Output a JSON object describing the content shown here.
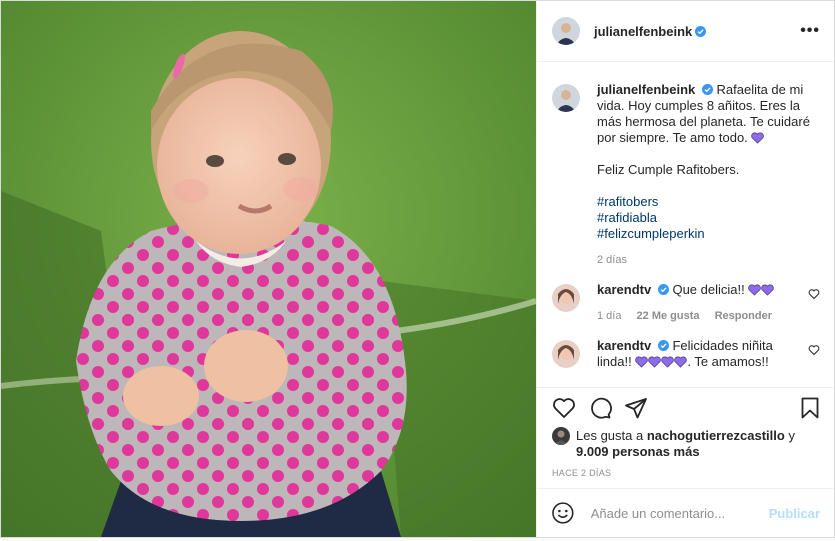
{
  "post": {
    "author": "julianelfenbeink",
    "more_label": "•••",
    "caption_lines": [
      "Rafaelita de mi vida. Hoy cumples 8 añitos. Eres la más hermosa del planeta. Te cuidaré por siempre. Te amo todo."
    ],
    "caption_second": "Feliz Cumple Rafitobers.",
    "hashtags": [
      "#rafitobers",
      "#rafidiabla",
      "#felizcumpleperkin"
    ],
    "caption_time": "2 días"
  },
  "comments": [
    {
      "user": "karendtv",
      "text": "Que delicia!!",
      "time": "1 día",
      "likes": "22 Me gusta",
      "reply": "Responder"
    },
    {
      "user": "karendtv",
      "text_before": "Felicidades niñita linda!!",
      "text_after": ". Te amamos!!"
    }
  ],
  "likes": {
    "prefix": "Les gusta a",
    "user": "nachogutierrezcastillo",
    "conj": "y",
    "count": "9.009 personas más"
  },
  "time_ago": "HACE 2 DÍAS",
  "add_comment": {
    "placeholder": "Añade un comentario...",
    "publish": "Publicar"
  },
  "colors": {
    "verified": "#3897f0",
    "link": "#00376b",
    "heart_purple": "#8c6ce8",
    "publish_disabled": "#b2dffc"
  },
  "icons": [
    "verified-icon",
    "heart-icon",
    "comment-icon",
    "share-icon",
    "bookmark-icon",
    "emoji-icon",
    "purple-heart-icon"
  ]
}
